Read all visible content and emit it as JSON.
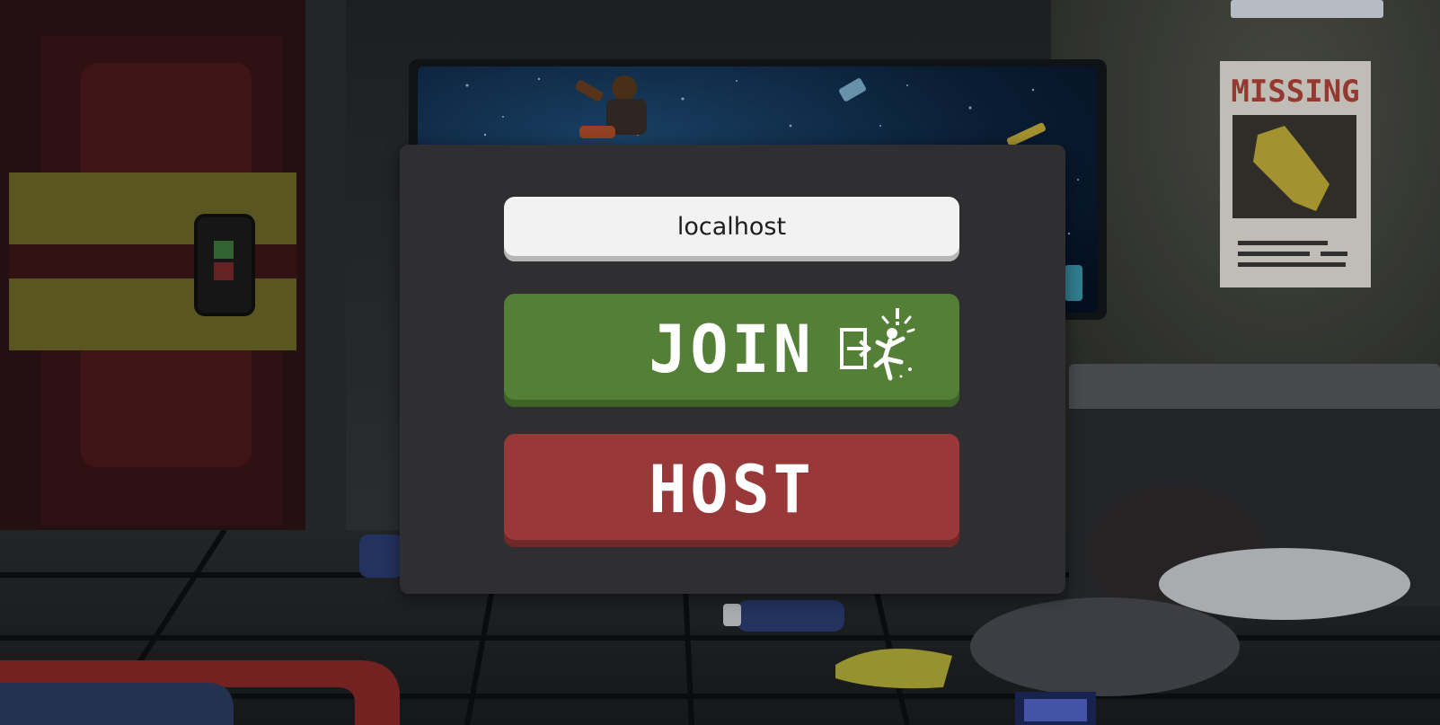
{
  "server": {
    "address_value": "localhost",
    "address_placeholder": "localhost"
  },
  "join_button": {
    "label": "JOIN",
    "icon": "door-exit-icon",
    "color": "#537f36"
  },
  "host_button": {
    "label": "HOST",
    "color": "#983838"
  },
  "background": {
    "poster_title": "MISSING"
  },
  "colors": {
    "panel": "#2f2f31",
    "input": "#f2f2f2",
    "poster_title": "#b5453b"
  }
}
